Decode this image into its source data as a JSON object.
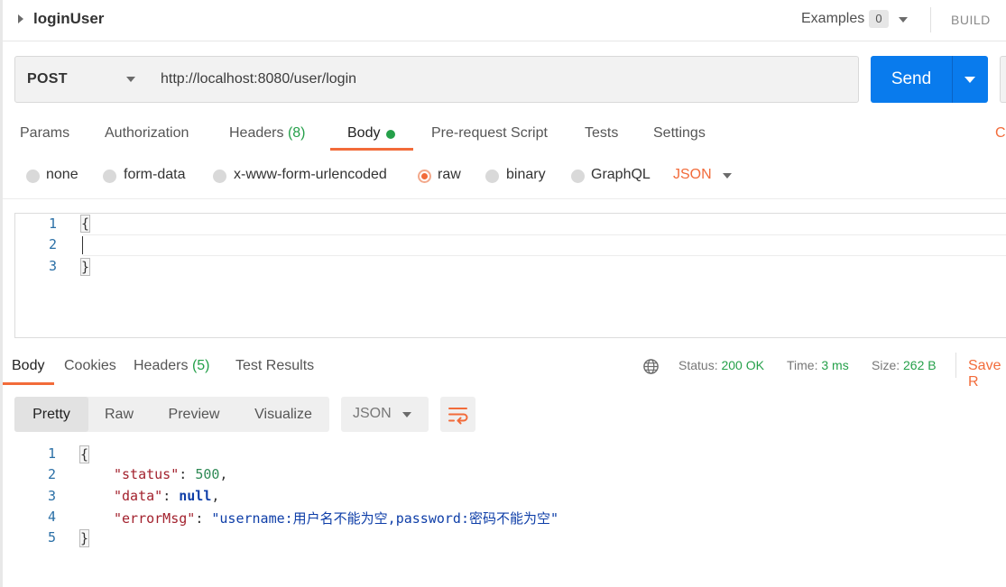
{
  "request": {
    "title": "loginUser",
    "examples_label": "Examples",
    "examples_count": "0",
    "build_label": "BUILD",
    "method": "POST",
    "url": "http://localhost:8080/user/login",
    "send_label": "Send"
  },
  "request_tabs": {
    "params": "Params",
    "authorization": "Authorization",
    "headers": "Headers",
    "headers_count": "(8)",
    "body": "Body",
    "prerequest": "Pre-request Script",
    "tests": "Tests",
    "settings": "Settings",
    "cookies_partial": "C"
  },
  "body_types": {
    "none": "none",
    "form_data": "form-data",
    "urlencoded": "x-www-form-urlencoded",
    "raw": "raw",
    "binary": "binary",
    "graphql": "GraphQL",
    "selected": "raw",
    "format": "JSON"
  },
  "request_body": {
    "line_numbers": [
      "1",
      "2",
      "3"
    ],
    "open": "{",
    "close": "}"
  },
  "response_tabs": {
    "body": "Body",
    "cookies": "Cookies",
    "headers": "Headers",
    "headers_count": "(5)",
    "test_results": "Test Results"
  },
  "response_meta": {
    "status_label": "Status:",
    "status_value": "200 OK",
    "time_label": "Time:",
    "time_value": "3 ms",
    "size_label": "Size:",
    "size_value": "262 B",
    "save_partial": "Save R"
  },
  "response_toolbar": {
    "pretty": "Pretty",
    "raw": "Raw",
    "preview": "Preview",
    "visualize": "Visualize",
    "format": "JSON",
    "active_view": "Pretty"
  },
  "response_body": {
    "line_numbers": [
      "1",
      "2",
      "3",
      "4",
      "5"
    ],
    "open": "{",
    "close": "}",
    "fields": [
      {
        "key": "\"status\"",
        "sep": ": ",
        "value": "500",
        "trail": ","
      },
      {
        "key": "\"data\"",
        "sep": ": ",
        "value": "null",
        "trail": ","
      },
      {
        "key": "\"errorMsg\"",
        "sep": ": ",
        "value": "\"username:用户名不能为空,password:密码不能为空\"",
        "trail": ""
      }
    ]
  },
  "colors": {
    "accent_orange": "#f26b3a",
    "send_blue": "#097bed",
    "success_green": "#25a04a"
  },
  "icons": [
    "caret-right-icon",
    "chevron-down-icon",
    "globe-icon",
    "wrap-lines-icon"
  ]
}
